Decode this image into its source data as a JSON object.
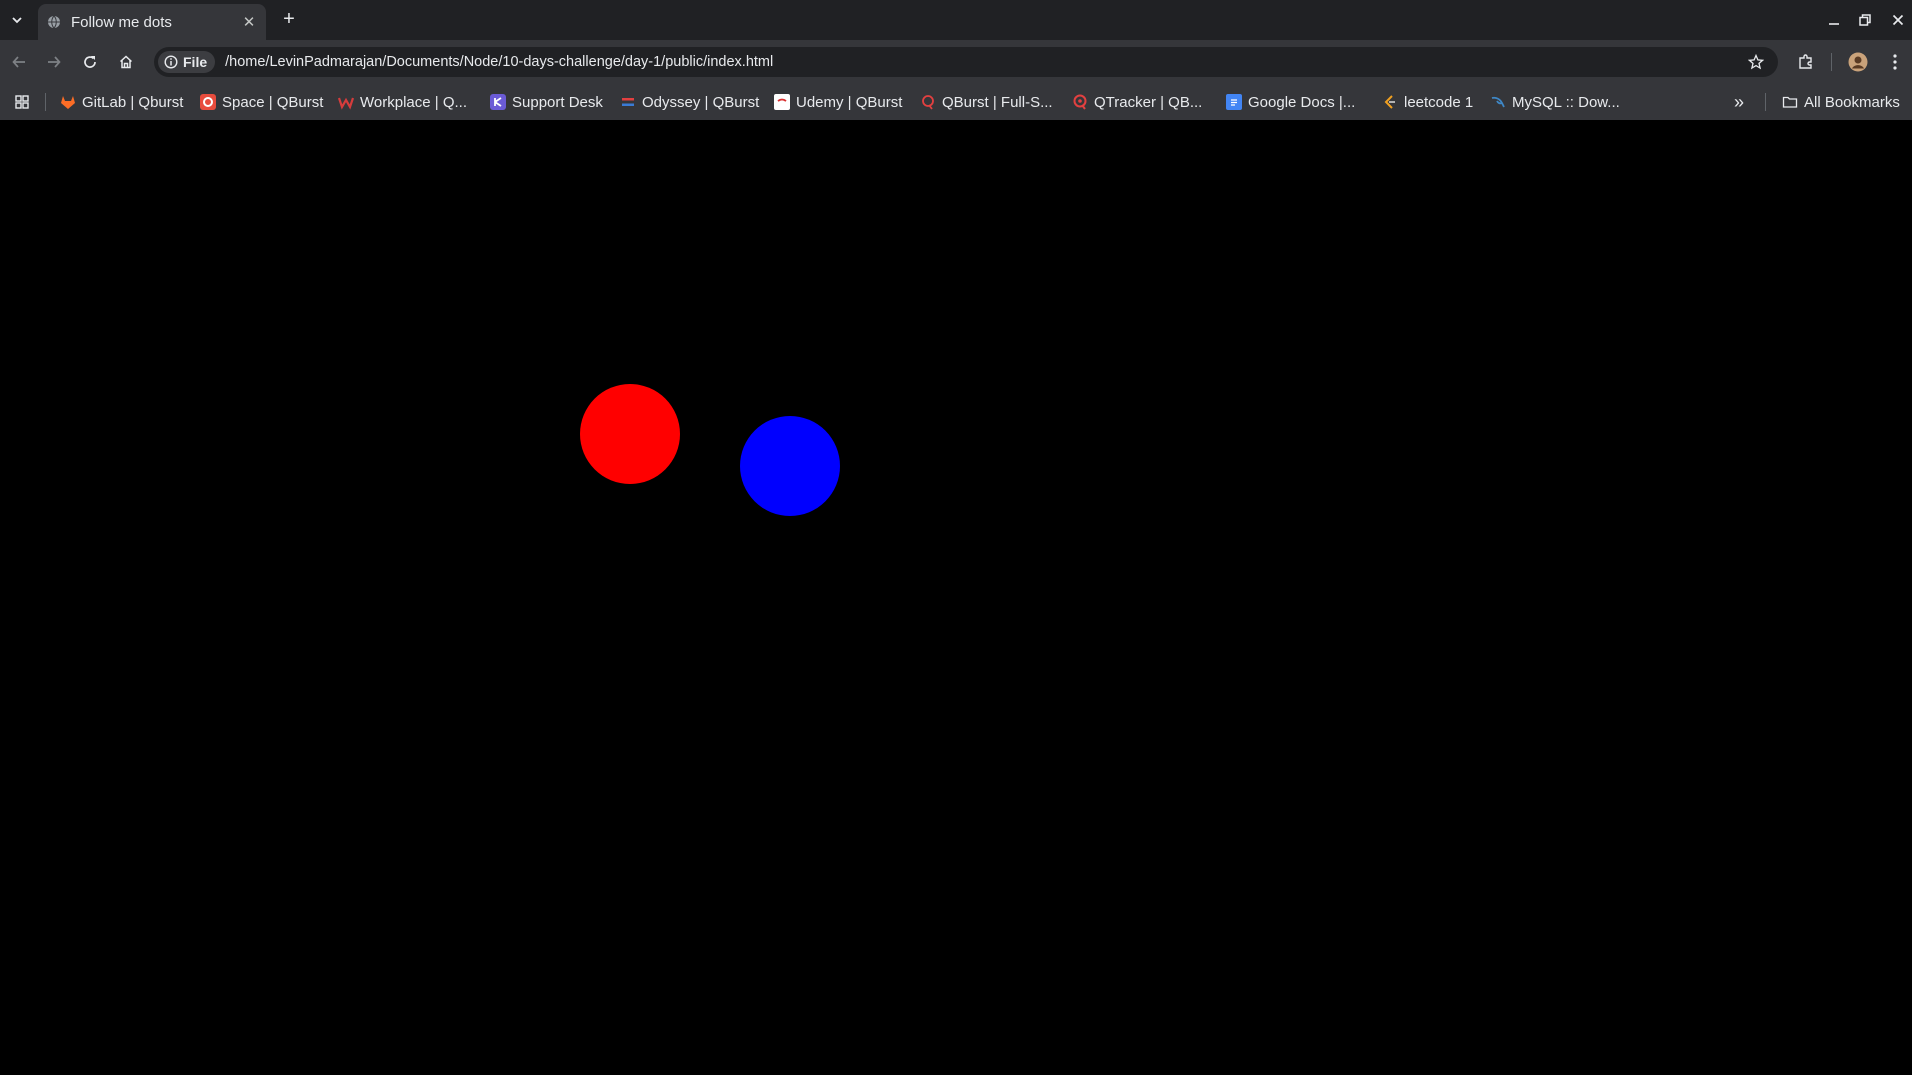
{
  "tab": {
    "title": "Follow me dots",
    "close_icon": "close-icon",
    "new_tab": "+"
  },
  "omnibox": {
    "scheme_chip": "File",
    "url": "/home/LevinPadmarajan/Documents/Node/10-days-challenge/day-1/public/index.html"
  },
  "bookmarks": {
    "items": [
      {
        "label": "GitLab | Qburst",
        "icon": "gitlab-icon",
        "color": "#fc6d26"
      },
      {
        "label": "Space | QBurst",
        "icon": "space-icon",
        "color": "#e84c3d"
      },
      {
        "label": "Workplace | Q...",
        "icon": "workplace-icon",
        "color": "#d63c3c"
      },
      {
        "label": "Support Desk",
        "icon": "support-icon",
        "color": "#6b5bd6"
      },
      {
        "label": "Odyssey | QBurst",
        "icon": "odyssey-icon",
        "color": "#e34040"
      },
      {
        "label": "Udemy | QBurst",
        "icon": "udemy-icon",
        "color": "#ffffff"
      },
      {
        "label": "QBurst | Full-S...",
        "icon": "qburst-icon",
        "color": "#e34040"
      },
      {
        "label": "QTracker | QB...",
        "icon": "qtracker-icon",
        "color": "#e34040"
      },
      {
        "label": "Google Docs |...",
        "icon": "google-docs-icon",
        "color": "#4285f4"
      },
      {
        "label": "leetcode 1",
        "icon": "leetcode-icon",
        "color": "#f0a020"
      },
      {
        "label": "MySQL :: Dow...",
        "icon": "mysql-icon",
        "color": "#3e87c6"
      }
    ],
    "overflow": "»",
    "all_bookmarks": "All Bookmarks"
  },
  "page": {
    "background": "#000000",
    "dots": [
      {
        "name": "red-dot",
        "color": "#ff0000"
      },
      {
        "name": "blue-dot",
        "color": "#0000ff"
      }
    ]
  }
}
